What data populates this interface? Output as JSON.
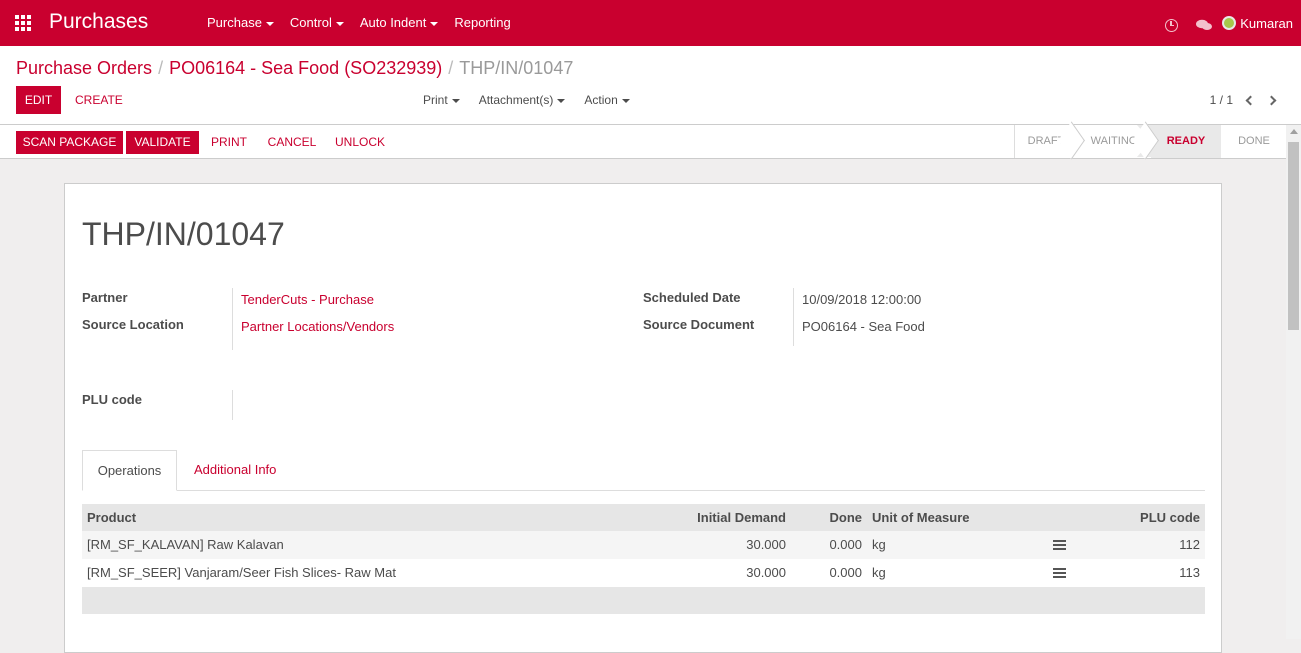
{
  "nav": {
    "brand": "Purchases",
    "menu": [
      "Purchase",
      "Control",
      "Auto Indent",
      "Reporting"
    ],
    "user": "Kumaran"
  },
  "breadcrumb": {
    "level1": "Purchase Orders",
    "level2": "PO06164 - Sea Food (SO232939)",
    "current": "THP/IN/01047",
    "separator": "/"
  },
  "actions": {
    "edit": "EDIT",
    "create": "CREATE",
    "print": "Print",
    "attachments": "Attachment(s)",
    "action": "Action",
    "pager": "1 / 1"
  },
  "statusbar": {
    "buttons": [
      "SCAN PACKAGE",
      "VALIDATE",
      "PRINT",
      "CANCEL",
      "UNLOCK"
    ],
    "stages": [
      "DRAFT",
      "WAITING",
      "READY",
      "DONE"
    ],
    "active_stage": "READY"
  },
  "record": {
    "title": "THP/IN/01047",
    "partner_label": "Partner",
    "partner": "TenderCuts - Purchase",
    "source_location_label": "Source Location",
    "source_location": "Partner Locations/Vendors",
    "scheduled_date_label": "Scheduled Date",
    "scheduled_date": "10/09/2018 12:00:00",
    "source_document_label": "Source Document",
    "source_document": "PO06164 - Sea Food",
    "plu_label": "PLU code"
  },
  "tabs": [
    "Operations",
    "Additional Info"
  ],
  "table": {
    "headers": [
      "Product",
      "Initial Demand",
      "Done",
      "Unit of Measure",
      "PLU code"
    ],
    "rows": [
      {
        "product": "[RM_SF_KALAVAN] Raw Kalavan",
        "demand": "30.000",
        "done": "0.000",
        "uom": "kg",
        "plu": "112"
      },
      {
        "product": "[RM_SF_SEER] Vanjaram/Seer Fish Slices- Raw Mat",
        "demand": "30.000",
        "done": "0.000",
        "uom": "kg",
        "plu": "113"
      }
    ]
  },
  "colors": {
    "primary": "#c9002f"
  }
}
